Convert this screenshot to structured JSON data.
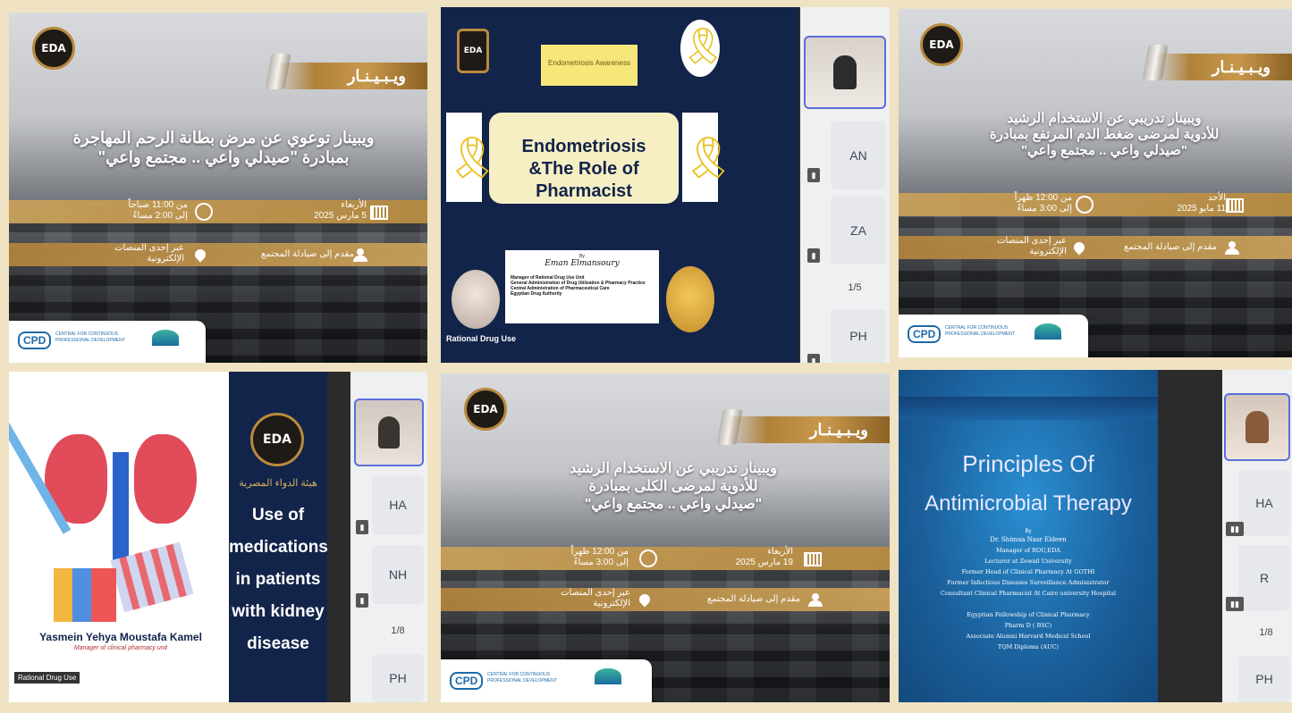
{
  "colors": {
    "gold": "#b0823a",
    "navy": "#13244a",
    "accent_blue": "#5b6ed8",
    "page_bg": "#efe3c3"
  },
  "logo": {
    "text": "EDA"
  },
  "webinar_label": "ويـبـيـنـار",
  "poster1": {
    "title_line1": "ويبينار توعوي عن مرض بطانة الرحم المهاجرة",
    "title_line2": "بمبادرة \"صيدلي واعي .. مجتمع واعي\"",
    "day": "الأربعاء",
    "date": "5 مارس 2025",
    "time_from": "من 11:00 صباحاً",
    "time_to": "إلى 2:00 مساءً",
    "presenter": "مقدم إلى صيادلة المجتمع",
    "platform_line1": "عبر إحدى المنصات",
    "platform_line2": "الإلكترونية"
  },
  "poster2": {
    "title_line1": "ويبينار تدريبي عن الاستخدام الرشيد",
    "title_line2": "للأدوية لمرضى ضغط الدم المرتفع بمبادرة",
    "title_line3": "\"صيدلي واعي .. مجتمع واعي\"",
    "day": "الأحد",
    "date": "11 مايو 2025",
    "time_from": "من 12:00 ظهراً",
    "time_to": "إلى 3:00 مساءً",
    "presenter": "مقدم إلى صيادلة المجتمع",
    "platform_line1": "عبر إحدى المنصات",
    "platform_line2": "الإلكترونية"
  },
  "poster3": {
    "title_line1": "ويبينار تدريبي عن الاستخدام الرشيد",
    "title_line2": "للأدوية لمرضى الكلى بمبادرة",
    "title_line3": "\"صيدلي واعي .. مجتمع واعي\"",
    "day": "الأربعاء",
    "date": "19 مارس 2025",
    "time_from": "من 12:00 ظهراً",
    "time_to": "إلى 3:00 مساءً",
    "presenter": "مقدم إلى صيادلة المجتمع",
    "platform_line1": "عبر إحدى المنصات",
    "platform_line2": "الإلكترونية"
  },
  "cpd": {
    "logo": "CPD",
    "text_line1": "CENTRAL FOR CONTINUOUS",
    "text_line2": "PROFESSIONAL DEVELOPMENT"
  },
  "slide1": {
    "title": "Endometriosis &The Role of Pharmacist",
    "by": "By",
    "author": "Eman Elmansoury",
    "role_line1": "Manager of Rational Drug Use Unit",
    "role_line2": "General Administration of Drug Utilization & Pharmacy Practice",
    "role_line3": "Central Administration of Pharmaceutical Care",
    "role_line4": "Egyptian Drug Authority",
    "badge": "Endometriosis Awareness",
    "corner_label": "Rational Drug Use"
  },
  "slide2": {
    "title_line1": "Use of",
    "title_line2": "medications",
    "title_line3": "in patients",
    "title_line4": "with kidney",
    "title_line5": "disease",
    "presenter": "Yasmein Yehya Moustafa Kamel",
    "role": "Manager of clinical pharmacy unit",
    "corner_label": "Rational Drug Use",
    "arabic_name": "هيئة الدواء المصرية"
  },
  "slide3": {
    "title_line1": "Principles Of",
    "title_line2": "Antimicrobial Therapy",
    "by": "By",
    "author": "Dr. Shimaa Nasr Eldeen",
    "lines": [
      "Manager of ROU,EDA",
      "Lecturer at Zewail University",
      "Former Head of Clinical Pharmacy At GOTHI",
      "Former Infectious Diseases Surveillance Administrator",
      "Consultant Clinical Pharmacist At Cairo university Hospital",
      "Egyptian Fellowship of Clinical Pharmacy",
      "Pharm D ( BSC)",
      "Associate Alumni Harvard Medical School",
      "TQM Diploma (AUC)"
    ]
  },
  "panel1": {
    "tiles": [
      "AN",
      "ZA",
      "PH"
    ],
    "pager": "1/5"
  },
  "panel2": {
    "tiles": [
      "HA",
      "NH",
      "PH"
    ],
    "pager": "1/8"
  },
  "panel3": {
    "tiles": [
      "HA",
      "R",
      "PH"
    ],
    "pager": "1/8"
  }
}
